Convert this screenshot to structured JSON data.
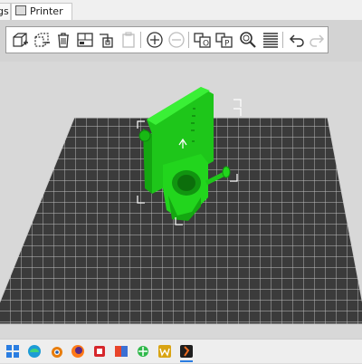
{
  "tabs": [
    {
      "label": "gs"
    },
    {
      "label": "Printer Settings"
    }
  ],
  "toolbar": {
    "tools": [
      "add-icon",
      "delete-icon",
      "delete-all-icon",
      "arrange-icon",
      "copy-icon",
      "paste-icon",
      "add-instance-icon",
      "remove-instance-icon",
      "split-objects-icon",
      "split-parts-icon",
      "search-icon",
      "layers-icon",
      "undo-icon",
      "redo-icon"
    ],
    "disabled_tools": [
      "paste-icon",
      "remove-instance-icon",
      "redo-icon"
    ]
  },
  "viewport": {
    "bed_color": "#3b3b3b",
    "grid_color": "#d0d0d0",
    "model_color": "#25d91f",
    "model_shadow_color": "#139a10"
  },
  "taskbar": {
    "apps": [
      "start-icon",
      "edge-icon",
      "blender-icon",
      "firefox-icon",
      "app-red-icon",
      "app-color-icon",
      "app-green-icon",
      "app-w-icon",
      "prusaslicer-icon"
    ],
    "accent": "#2a7de1"
  }
}
